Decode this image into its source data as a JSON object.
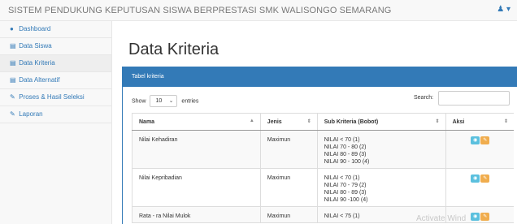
{
  "topbar": {
    "brand": "SISTEM PENDUKUNG KEPUTUSAN SISWA BERPRESTASI SMK WALISONGO SEMARANG",
    "user_icon": "user-icon",
    "user_caret": "▾"
  },
  "sidebar": {
    "items": [
      {
        "label": "Dashboard",
        "icon": "dashboard-icon",
        "glyph": "●"
      },
      {
        "label": "Data Siswa",
        "icon": "table-icon",
        "glyph": "▤"
      },
      {
        "label": "Data Kriteria",
        "icon": "table-icon",
        "glyph": "▤"
      },
      {
        "label": "Data Alternatif",
        "icon": "table-icon",
        "glyph": "▤"
      },
      {
        "label": "Proses & Hasil Seleksi",
        "icon": "edit-icon",
        "glyph": "✎"
      },
      {
        "label": "Laporan",
        "icon": "edit-icon",
        "glyph": "✎"
      }
    ],
    "active_index": 2
  },
  "page": {
    "title": "Data Kriteria"
  },
  "panel": {
    "heading": "Tabel kriteria",
    "show_label": "Show",
    "entries_value": "10",
    "entries_label": "entries",
    "search_label": "Search:",
    "search_value": ""
  },
  "table": {
    "columns": [
      "Nama",
      "Jenis",
      "Sub Kriteria (Bobot)",
      "Aksi"
    ],
    "rows": [
      {
        "nama": "Nilai Kehadiran",
        "jenis": "Maximun",
        "sub": [
          "NILAI < 70 (1)",
          "NILAI 70 - 80 (2)",
          "NILAI 80 - 89 (3)",
          "NILAI 90 - 100 (4)"
        ]
      },
      {
        "nama": "Nilai Kepribadian",
        "jenis": "Maximun",
        "sub": [
          "NILAI < 70 (1)",
          "NILAI 70 - 79 (2)",
          "NILAI 80 - 89 (3)",
          "NILAI 90 -100 (4)"
        ]
      },
      {
        "nama": "Rata - ra Nilai Mulok",
        "jenis": "Maximun",
        "sub": [
          "NILAI < 75 (1)"
        ]
      }
    ]
  },
  "watermark": "Activate Wind",
  "colors": {
    "primary": "#337ab7",
    "info": "#5bc0de",
    "warning": "#f0ad4e"
  }
}
